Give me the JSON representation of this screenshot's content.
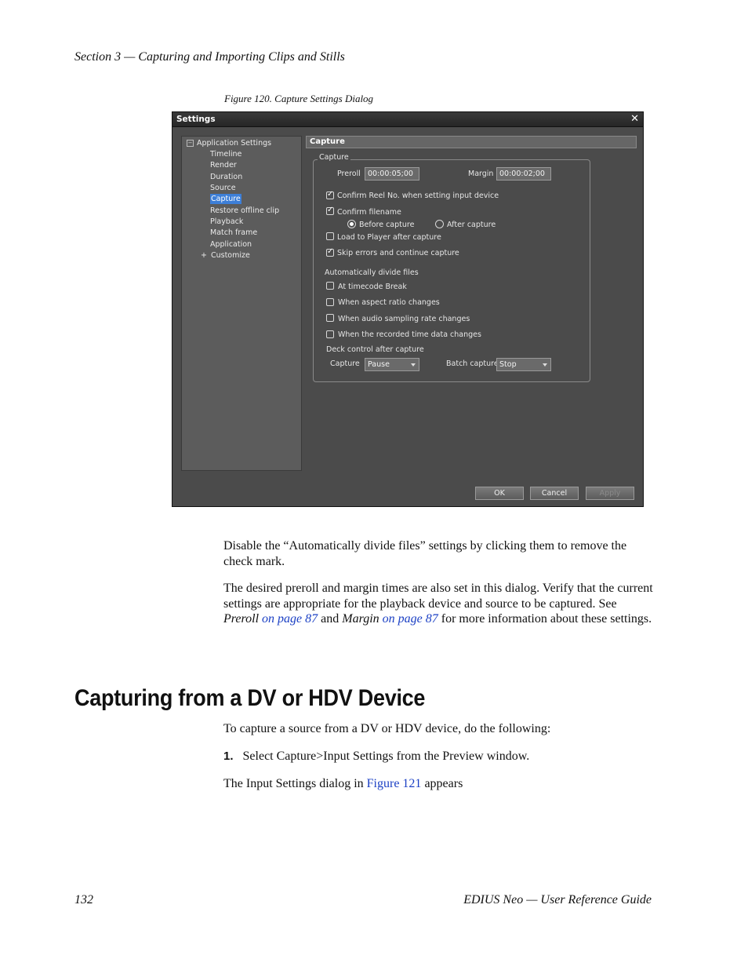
{
  "header": {
    "running_head": "Section 3 — Capturing and Importing Clips and Stills"
  },
  "figure": {
    "caption": "Figure 120.  Capture Settings Dialog"
  },
  "dialog": {
    "title": "Settings",
    "close": "✕",
    "tree": {
      "root": "Application Settings",
      "root_toggle": "−",
      "items": [
        "Timeline",
        "Render",
        "Duration",
        "Source",
        "Capture",
        "Restore offline clip",
        "Playback",
        "Match frame",
        "Application",
        "Customize"
      ],
      "selected": "Capture",
      "customize_toggle": "+"
    },
    "panel_title": "Capture",
    "group_title": "Capture",
    "preroll_label": "Preroll",
    "preroll_value": "00:00:05;00",
    "margin_label": "Margin",
    "margin_value": "00:00:02;00",
    "confirm_reel": {
      "label": "Confirm Reel No. when setting input device",
      "checked": true
    },
    "confirm_filename": {
      "label": "Confirm filename",
      "checked": true
    },
    "before_capture": {
      "label": "Before capture",
      "selected": true
    },
    "after_capture": {
      "label": "After capture",
      "selected": false
    },
    "load_to_player": {
      "label": "Load to Player after capture",
      "checked": false
    },
    "skip_errors": {
      "label": "Skip errors and continue capture",
      "checked": true
    },
    "auto_divide_label": "Automatically divide files",
    "at_timecode_break": {
      "label": "At timecode Break",
      "checked": false
    },
    "aspect_ratio": {
      "label": "When aspect ratio changes",
      "checked": false
    },
    "audio_sampling": {
      "label": "When audio sampling rate changes",
      "checked": false
    },
    "recorded_time": {
      "label": "When the recorded time data changes",
      "checked": false
    },
    "deck_control_label": "Deck control after capture",
    "capture_label": "Capture",
    "capture_value": "Pause",
    "batch_label": "Batch capture",
    "batch_value": "Stop",
    "ok_label": "OK",
    "cancel_label": "Cancel",
    "apply_label": "Apply"
  },
  "body": {
    "para1": "Disable the “Automatically divide files” settings by clicking them to remove the check mark.",
    "para2_a": "The desired preroll and margin times are also set in this dialog. Verify that the current settings are appropriate for the playback device and source to be captured. See ",
    "para2_preroll": "Preroll",
    "para2_link1": "on page 87",
    "para2_and": " and ",
    "para2_margin": "Margin",
    "para2_link2": "on page 87",
    "para2_b": " for more informa­tion about these settings.",
    "heading": "Capturing from a DV or HDV Device",
    "intro": "To capture a source from a DV or HDV device, do the following:",
    "step1_num": "1.",
    "step1_text": "Select Capture>Input Settings from the Preview window.",
    "para3_a": "The Input Settings dialog in ",
    "para3_link": "Figure 121",
    "para3_b": " appears"
  },
  "footer": {
    "page_number": "132",
    "guide_title": "EDIUS Neo  —  User Reference Guide"
  },
  "colors": {
    "link": "#1a3fc4",
    "dialog_bg": "#4b4b4b",
    "selection": "#3d7fd8"
  }
}
